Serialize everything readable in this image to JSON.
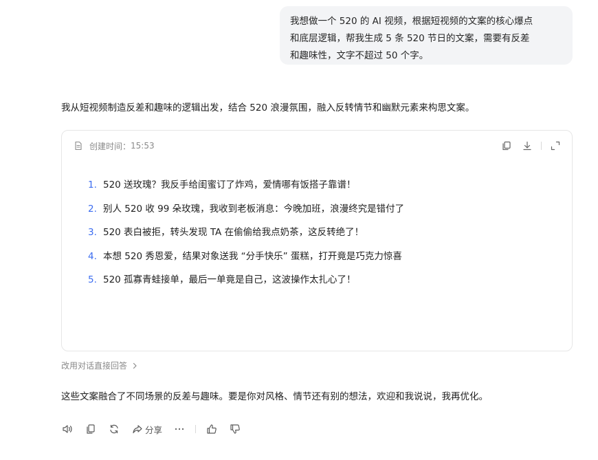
{
  "user_message": {
    "lines": [
      "我想做一个 520 的 AI 视频，根据短视频的文案的核心爆点",
      "和底层逻辑，帮我生成 5 条 520 节日的文案，需要有反差",
      "和趣味性，文字不超过 50 个字。"
    ]
  },
  "reply": {
    "intro": "我从短视频制造反差和趣味的逻辑出发，结合 520 浪漫氛围，融入反转情节和幽默元素来构思文案。",
    "doc": {
      "created_label": "创建时间：",
      "created_time": "15:53",
      "items": [
        {
          "num": "1.",
          "text": "520 送玫瑰？我反手给闺蜜订了炸鸡，爱情哪有饭搭子靠谱！"
        },
        {
          "num": "2.",
          "text": "别人 520 收 99 朵玫瑰，我收到老板消息：今晚加班，浪漫终究是错付了"
        },
        {
          "num": "3.",
          "text": "520 表白被拒，转头发现 TA 在偷偷给我点奶茶，这反转绝了！"
        },
        {
          "num": "4.",
          "text": "本想 520 秀恩爱，结果对象送我 “分手快乐” 蛋糕，打开竟是巧克力惊喜"
        },
        {
          "num": "5.",
          "text": "520 孤寡青蛙接单，最后一单竟是自己，这波操作太扎心了！"
        }
      ]
    },
    "continue_label": "改用对话直接回答",
    "closing": "这些文案融合了不同场景的反差与趣味。要是你对风格、情节还有别的想法，欢迎和我说说，我再优化。",
    "actions": {
      "share_label": "分享"
    }
  },
  "colors": {
    "accent_number": "#3b6cf0",
    "bubble_bg": "#f3f4f6",
    "muted_text": "#8a8a8a"
  }
}
